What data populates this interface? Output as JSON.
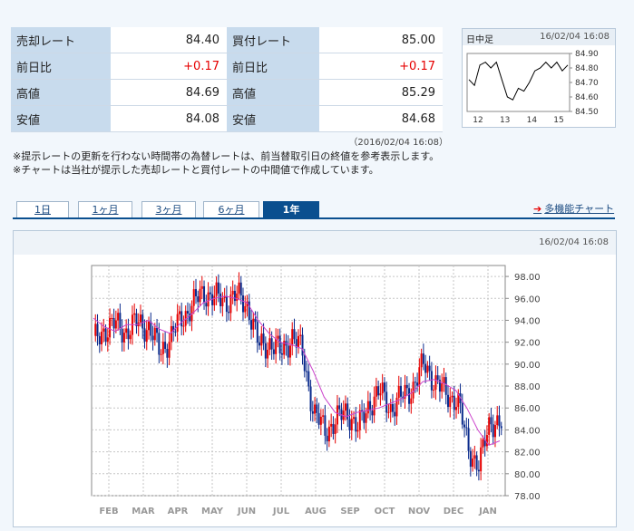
{
  "quote": {
    "sell_label": "売却レート",
    "sell_value": "84.40",
    "buy_label": "買付レート",
    "buy_value": "85.00",
    "rows": [
      {
        "label": "前日比",
        "sell": "+0.17",
        "buy": "+0.17"
      },
      {
        "label": "高値",
        "sell": "84.69",
        "buy": "85.29"
      },
      {
        "label": "安値",
        "sell": "84.08",
        "buy": "84.68"
      }
    ]
  },
  "mini_chart": {
    "title": "日中足",
    "timestamp": "16/02/04 16:08",
    "y_ticks": [
      "84.90",
      "84.80",
      "84.70",
      "84.60",
      "84.50"
    ],
    "x_ticks": [
      "12",
      "13",
      "14",
      "15"
    ]
  },
  "notes": {
    "timestamp": "（2016/02/04 16:08）",
    "line1": "※提示レートの更新を行わない時間帯の為替レートは、前当替取引日の終値を参考表示します。",
    "line2": "※チャートは当社が提示した売却レートと買付レートの中間値で作成しています。"
  },
  "tabs": [
    "1日",
    "1ヶ月",
    "3ヶ月",
    "6ヶ月",
    "1年"
  ],
  "active_tab": "1年",
  "multi_link": "多機能チャート",
  "chart_timestamp": "16/02/04 16:08",
  "colors": {
    "up": "#e60000",
    "down": "#0a2a8c",
    "ma": "#cc44cc",
    "accent": "#0a4f8f"
  },
  "chart_data": [
    {
      "type": "candlestick",
      "x_ticks": [
        "FEB",
        "MAR",
        "APR",
        "MAY",
        "JUN",
        "JUL",
        "AUG",
        "SEP",
        "OCT",
        "NOV",
        "DEC",
        "JAN"
      ],
      "y_ticks": [
        "98.00",
        "96.00",
        "94.00",
        "92.00",
        "90.00",
        "88.00",
        "86.00",
        "84.00",
        "82.00",
        "80.00",
        "78.00"
      ],
      "ylim": [
        78,
        99
      ],
      "grid": true,
      "series": [
        {
          "values": [
            92.0,
            93.2,
            93.6,
            93.0,
            93.8,
            93.4,
            91.2,
            92.4,
            94.2,
            95.4,
            96.6,
            96.0,
            95.8,
            96.2,
            95.4,
            91.6,
            92.0,
            91.0,
            92.6,
            91.0,
            85.4,
            84.0,
            84.8,
            85.8,
            84.0,
            86.4,
            87.4,
            86.0,
            87.0,
            88.0,
            90.0,
            88.4,
            87.2,
            86.8,
            82.4,
            80.6,
            85.0,
            84.4
          ]
        },
        {
          "values": [
            94.2,
            93.4,
            93.0,
            93.6,
            93.6,
            94.0,
            93.2,
            92.8,
            93.8,
            94.6,
            95.6,
            96.0,
            96.2,
            96.0,
            95.6,
            94.0,
            92.8,
            92.0,
            91.8,
            91.4,
            89.4,
            87.0,
            85.6,
            85.2,
            85.6,
            85.8,
            86.0,
            86.4,
            86.8,
            87.4,
            88.4,
            88.6,
            88.2,
            87.6,
            86.0,
            84.0,
            82.6,
            83.0
          ]
        }
      ]
    },
    {
      "type": "line",
      "x_ticks": [
        "12",
        "13",
        "14",
        "15"
      ],
      "y_ticks": [
        "84.90",
        "84.80",
        "84.70",
        "84.60",
        "84.50"
      ],
      "ylim": [
        84.5,
        84.9
      ],
      "values": [
        84.72,
        84.68,
        84.82,
        84.84,
        84.8,
        84.84,
        84.72,
        84.6,
        84.58,
        84.66,
        84.64,
        84.7,
        84.78,
        84.8,
        84.84,
        84.8,
        84.84,
        84.78,
        84.82
      ]
    }
  ]
}
